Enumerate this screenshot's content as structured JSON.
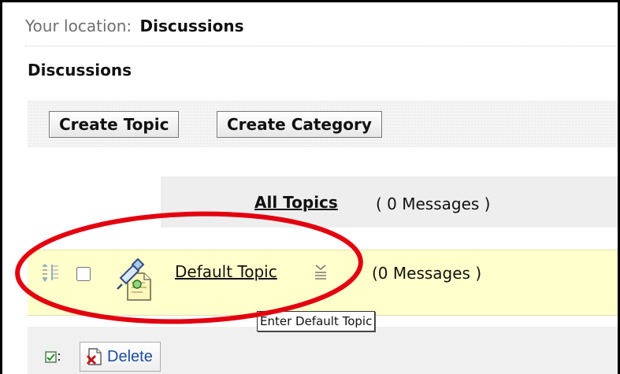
{
  "location": {
    "prefix": "Your location:",
    "current": "Discussions"
  },
  "page": {
    "title": "Discussions"
  },
  "toolbar": {
    "create_topic_label": "Create Topic",
    "create_category_label": "Create Category"
  },
  "all_topics": {
    "label": "All Topics",
    "count_text": "( 0 Messages )"
  },
  "topics": [
    {
      "title": "Default Topic",
      "count_text": "(0 Messages )",
      "selected": false,
      "tooltip": "Enter Default Topic"
    }
  ],
  "actions": {
    "delete_label": "Delete"
  },
  "icons": {
    "drag": "move-topic-icon",
    "topic": "topic-icon",
    "menu": "menu-icon",
    "bulk_select": "bulk-select-icon",
    "delete": "delete-icon"
  },
  "colors": {
    "highlight_row": "#ffffcc",
    "section_gray": "#eeeeee",
    "link": "#1c4ea0",
    "annotation_red": "#e3000f"
  }
}
